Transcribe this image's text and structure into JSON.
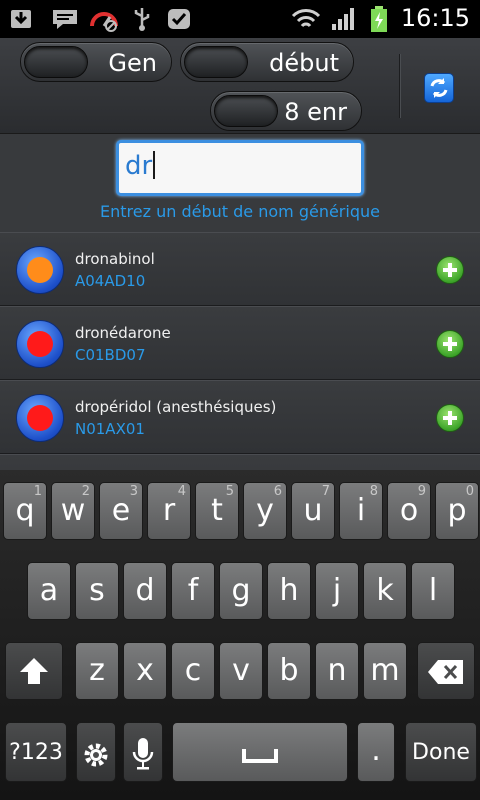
{
  "status_bar": {
    "time": "16:15",
    "icons": [
      "download-icon",
      "message-icon",
      "speed-icon",
      "usb-icon",
      "check-icon",
      "wifi-icon",
      "signal-icon",
      "battery-charging-icon"
    ]
  },
  "toolbar": {
    "toggle_gen": "Gen",
    "toggle_debut": "début",
    "toggle_enr": "8 enr",
    "refresh_icon": "refresh-icon"
  },
  "search": {
    "value": "dr",
    "hint": "Entrez un début de nom générique"
  },
  "results": [
    {
      "name": "dronabinol",
      "code": "A04AD10",
      "dot_color": "#ff8c1a"
    },
    {
      "name": "dronédarone",
      "code": "C01BD07",
      "dot_color": "#ff1a1a"
    },
    {
      "name": "dropéridol (anesthésiques)",
      "code": "N01AX01",
      "dot_color": "#ff1a1a"
    }
  ],
  "keyboard": {
    "row1": [
      {
        "k": "q",
        "n": "1"
      },
      {
        "k": "w",
        "n": "2"
      },
      {
        "k": "e",
        "n": "3"
      },
      {
        "k": "r",
        "n": "4"
      },
      {
        "k": "t",
        "n": "5"
      },
      {
        "k": "y",
        "n": "6"
      },
      {
        "k": "u",
        "n": "7"
      },
      {
        "k": "i",
        "n": "8"
      },
      {
        "k": "o",
        "n": "9"
      },
      {
        "k": "p",
        "n": "0"
      }
    ],
    "row2": [
      "a",
      "s",
      "d",
      "f",
      "g",
      "h",
      "j",
      "k",
      "l"
    ],
    "row3": [
      "z",
      "x",
      "c",
      "v",
      "b",
      "n",
      "m"
    ],
    "symbols_label": "?123",
    "period_label": ".",
    "done_label": "Done"
  }
}
